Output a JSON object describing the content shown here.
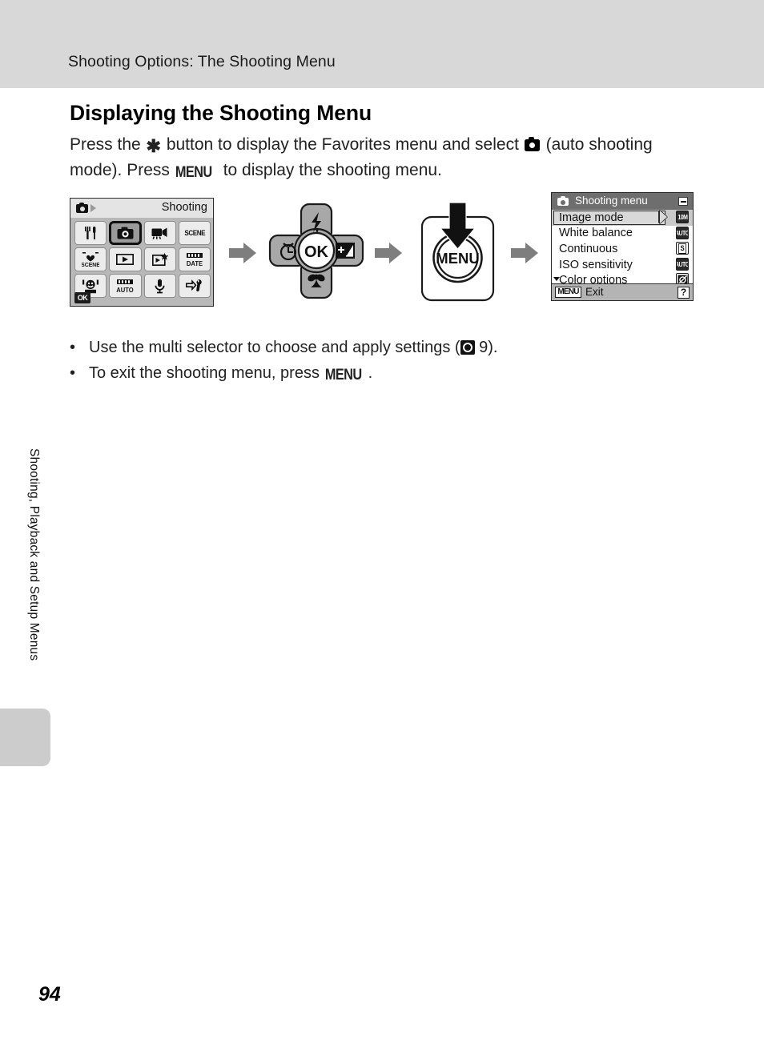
{
  "header": {
    "running_title": "Shooting Options: The Shooting Menu"
  },
  "section": {
    "heading": "Displaying the Shooting Menu",
    "intro_part1": "Press the ",
    "intro_glyph1": "favorites-asterisk-icon",
    "intro_part2": " button to display the Favorites menu and select ",
    "intro_glyph2": "auto-shooting-camera-icon",
    "intro_part3": " (auto shooting mode). Press ",
    "intro_glyph3": "MENU",
    "intro_part4": " to display the shooting menu."
  },
  "bullets": [
    {
      "marker": "•",
      "text_part1": "Use the multi selector to choose and apply settings (",
      "glyph": "manual-reference-icon",
      "text_part2": " 9)."
    },
    {
      "marker": "•",
      "text_part1": "To exit the shooting menu, press ",
      "glyph": "MENU",
      "text_part2": "."
    }
  ],
  "diagram": {
    "favorites_screen": {
      "title": "Shooting",
      "mode_icon": "camera-icon",
      "next_arrow_icon": "play-triangle-icon",
      "ok_badge": "OK",
      "cells": [
        {
          "name": "restaurant-food-mode",
          "icon": "fork-knife-icon",
          "label": "",
          "selected": false
        },
        {
          "name": "auto-shooting-mode",
          "icon": "camera-icon",
          "label": "",
          "selected": true
        },
        {
          "name": "movie-mode",
          "icon": "movie-camera-icon",
          "label": "",
          "selected": false
        },
        {
          "name": "scene-mode",
          "icon": "scene-text-icon",
          "label": "SCENE",
          "selected": false
        },
        {
          "name": "scene-favorite-mode",
          "icon": "scene-heart-icon",
          "label": "SCENE",
          "selected": false
        },
        {
          "name": "playback-mode",
          "icon": "play-icon",
          "label": "",
          "selected": false
        },
        {
          "name": "edit-image-mode",
          "icon": "edit-image-icon",
          "label": "",
          "selected": false
        },
        {
          "name": "date-mode",
          "icon": "date-text-icon",
          "label": "DATE",
          "selected": false
        },
        {
          "name": "smile-mode",
          "icon": "smile-face-icon",
          "label": "",
          "selected": false
        },
        {
          "name": "auto-scene-mode",
          "icon": "auto-text-icon",
          "label": "AUTO",
          "selected": false
        },
        {
          "name": "voice-recording-mode",
          "icon": "microphone-icon",
          "label": "",
          "selected": false
        },
        {
          "name": "setup-mode",
          "icon": "wrench-icon",
          "label": "",
          "selected": false
        }
      ]
    },
    "multi_selector": {
      "center_label": "OK",
      "up_icon": "flash-bolt-icon",
      "down_icon": "macro-flower-icon",
      "left_icon": "self-timer-clock-icon",
      "right_icon": "exposure-compensation-icon"
    },
    "menu_button": {
      "label": "MENU",
      "press_arrow_icon": "down-arrow-icon"
    },
    "shooting_menu_screen": {
      "title": "Shooting menu",
      "title_icon": "camera-icon",
      "collapse_icon": "minimize-icon",
      "scroll_icon": "scroll-down-caret-icon",
      "items": [
        {
          "label": "Image mode",
          "value_icon": "10M",
          "selected": true
        },
        {
          "label": "White balance",
          "value_icon": "AUTO",
          "selected": false
        },
        {
          "label": "Continuous",
          "value_icon": "S",
          "selected": false
        },
        {
          "label": "ISO sensitivity",
          "value_icon": "AUTO",
          "selected": false
        },
        {
          "label": "Color options",
          "value_icon": "color-off-icon",
          "selected": false
        }
      ],
      "footer": {
        "button_badge": "MENU",
        "action": "Exit",
        "help_badge": "?"
      }
    },
    "step_arrows": [
      "step-arrow-1",
      "step-arrow-2",
      "step-arrow-3"
    ]
  },
  "side_tab": {
    "chapter_label": "Shooting, Playback and Setup Menus"
  },
  "footer": {
    "page_number": "94"
  },
  "colors": {
    "header_band": "#d8d8d8",
    "tab_gray": "#cccccc",
    "lcd_body": "#b8b8b8",
    "menu_titlebar": "#6e6e6e",
    "selected_row": "#d9d9d9",
    "arrow_gray": "#808080"
  }
}
